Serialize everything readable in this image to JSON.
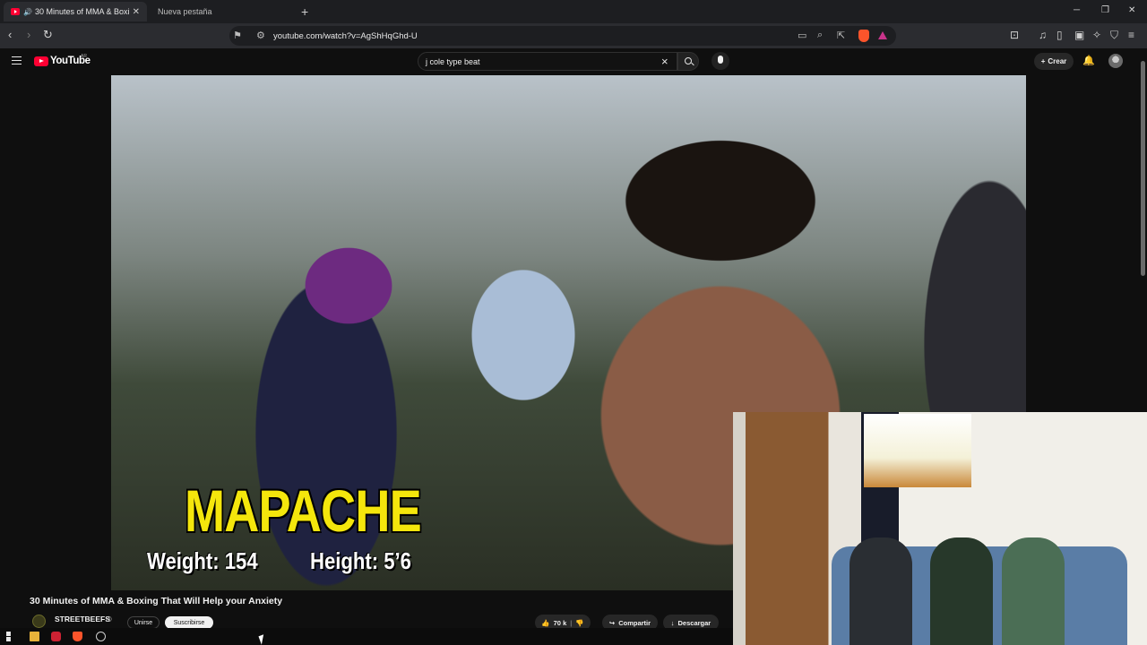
{
  "browser": {
    "tabs": [
      {
        "title": "30 Minutes of MMA & Boxing That Will Help your Anxiety",
        "speaker": "🔊",
        "close": "✕"
      },
      {
        "title": "Nueva pestaña"
      }
    ],
    "new_tab": "+",
    "window_controls": {
      "minimize": "─",
      "restore": "❐",
      "close": "✕"
    },
    "url": "youtube.com/watch?v=AgShHqGhd-U"
  },
  "youtube": {
    "logo_text": "YouTube",
    "country_code": "AR",
    "search_value": "j cole type beat",
    "create_label": "Crear",
    "video": {
      "overlay_name": "MAPACHE",
      "overlay_weight": "Weight: 154",
      "overlay_height": "Height: 5’6"
    },
    "title": "30 Minutes of MMA & Boxing That Will Help your Anxiety",
    "channel": {
      "name": "STREETBEEFS",
      "verified": "◎"
    },
    "join_label": "Unirse",
    "subscribe_label": "Suscribirse",
    "like_count": "70 k",
    "share_label": "Compartir",
    "download_label": "Descargar"
  },
  "colors": {
    "youtube_red": "#ff0033",
    "overlay_yellow": "#f4e60c",
    "brave_orange": "#fb542b"
  }
}
